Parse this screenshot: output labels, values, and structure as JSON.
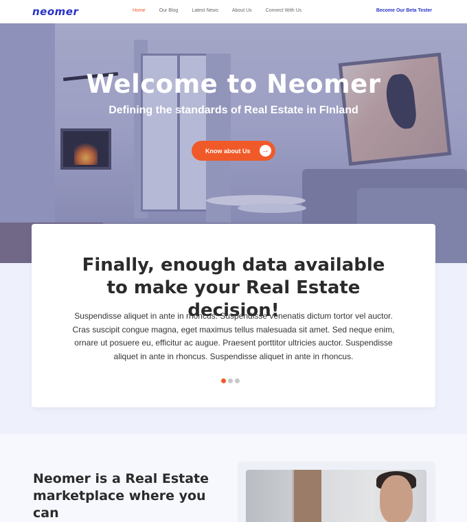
{
  "nav": {
    "logo": "neomer",
    "links": [
      "Home",
      "Our Blog",
      "Latest News",
      "About Us",
      "Connect With Us"
    ],
    "active_link": "Home",
    "beta_label": "Become Our Beta Tester"
  },
  "hero": {
    "title": "Welcome to Neomer",
    "subtitle": "Defining the standards of Real Estate in FInland",
    "cta_label": "Know about Us",
    "cta_icon": "arrow-right-icon"
  },
  "card": {
    "title": "Finally, enough data available to make your Real Estate decision!",
    "body": "Suspendisse aliquet in ante in rhoncus. Suspendisse venenatis dictum tortor vel auctor. Cras suscipit congue magna, eget maximus tellus malesuada sit amet. Sed neque enim, ornare ut posuere eu, efficitur ac augue. Praesent porttitor ultricies auctor. Suspendisse aliquet in ante in rhoncus. Suspendisse aliquet in ante in rhoncus.",
    "carousel_total": 3,
    "carousel_active": 1
  },
  "section2": {
    "title": "Neomer is a Real Estate marketplace where you can"
  },
  "colors": {
    "brand": "#2731c9",
    "accent": "#f05a28",
    "background": "#eef1fb"
  }
}
